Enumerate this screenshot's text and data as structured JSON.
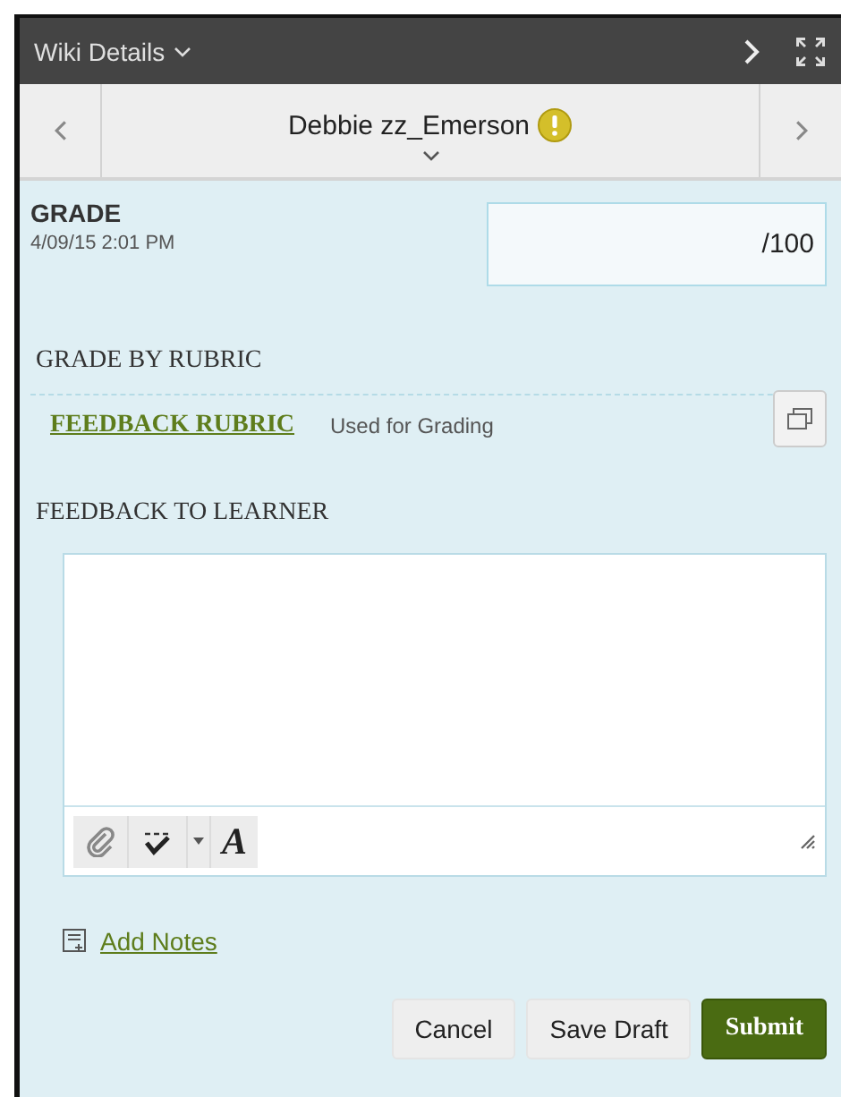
{
  "header": {
    "title": "Wiki Details"
  },
  "navigator": {
    "student": "Debbie zz_Emerson"
  },
  "grade": {
    "label": "GRADE",
    "date": "4/09/15 2:01 PM",
    "suffix": "/100"
  },
  "rubric": {
    "heading": "GRADE BY RUBRIC",
    "link": "FEEDBACK RUBRIC",
    "note": "Used for Grading"
  },
  "feedback": {
    "heading": "FEEDBACK TO LEARNER",
    "font_button": "A"
  },
  "notes_link": "Add Notes",
  "buttons": [
    {
      "label": "Cancel",
      "kind": "secondary"
    },
    {
      "label": "Save Draft",
      "kind": "secondary"
    },
    {
      "label": "Submit",
      "kind": "primary"
    }
  ]
}
